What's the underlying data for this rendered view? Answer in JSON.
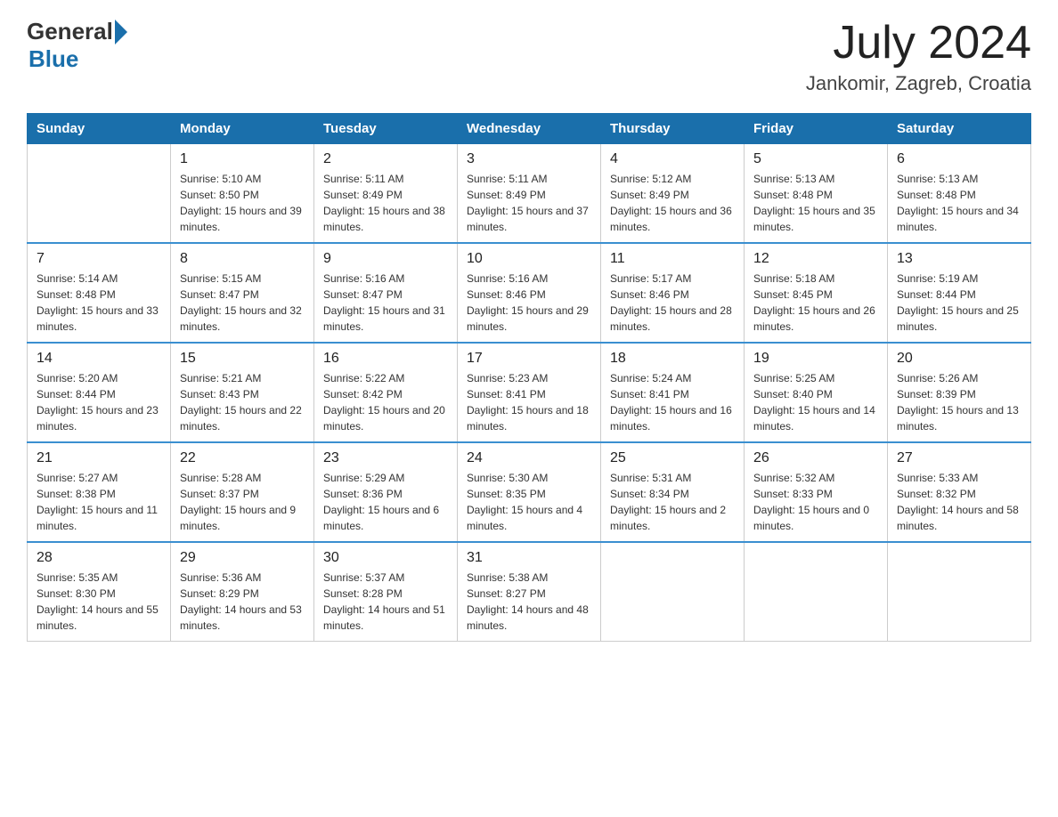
{
  "logo": {
    "general": "General",
    "blue": "Blue"
  },
  "title": {
    "month_year": "July 2024",
    "location": "Jankomir, Zagreb, Croatia"
  },
  "headers": [
    "Sunday",
    "Monday",
    "Tuesday",
    "Wednesday",
    "Thursday",
    "Friday",
    "Saturday"
  ],
  "weeks": [
    [
      {
        "day": "",
        "sunrise": "",
        "sunset": "",
        "daylight": ""
      },
      {
        "day": "1",
        "sunrise": "Sunrise: 5:10 AM",
        "sunset": "Sunset: 8:50 PM",
        "daylight": "Daylight: 15 hours and 39 minutes."
      },
      {
        "day": "2",
        "sunrise": "Sunrise: 5:11 AM",
        "sunset": "Sunset: 8:49 PM",
        "daylight": "Daylight: 15 hours and 38 minutes."
      },
      {
        "day": "3",
        "sunrise": "Sunrise: 5:11 AM",
        "sunset": "Sunset: 8:49 PM",
        "daylight": "Daylight: 15 hours and 37 minutes."
      },
      {
        "day": "4",
        "sunrise": "Sunrise: 5:12 AM",
        "sunset": "Sunset: 8:49 PM",
        "daylight": "Daylight: 15 hours and 36 minutes."
      },
      {
        "day": "5",
        "sunrise": "Sunrise: 5:13 AM",
        "sunset": "Sunset: 8:48 PM",
        "daylight": "Daylight: 15 hours and 35 minutes."
      },
      {
        "day": "6",
        "sunrise": "Sunrise: 5:13 AM",
        "sunset": "Sunset: 8:48 PM",
        "daylight": "Daylight: 15 hours and 34 minutes."
      }
    ],
    [
      {
        "day": "7",
        "sunrise": "Sunrise: 5:14 AM",
        "sunset": "Sunset: 8:48 PM",
        "daylight": "Daylight: 15 hours and 33 minutes."
      },
      {
        "day": "8",
        "sunrise": "Sunrise: 5:15 AM",
        "sunset": "Sunset: 8:47 PM",
        "daylight": "Daylight: 15 hours and 32 minutes."
      },
      {
        "day": "9",
        "sunrise": "Sunrise: 5:16 AM",
        "sunset": "Sunset: 8:47 PM",
        "daylight": "Daylight: 15 hours and 31 minutes."
      },
      {
        "day": "10",
        "sunrise": "Sunrise: 5:16 AM",
        "sunset": "Sunset: 8:46 PM",
        "daylight": "Daylight: 15 hours and 29 minutes."
      },
      {
        "day": "11",
        "sunrise": "Sunrise: 5:17 AM",
        "sunset": "Sunset: 8:46 PM",
        "daylight": "Daylight: 15 hours and 28 minutes."
      },
      {
        "day": "12",
        "sunrise": "Sunrise: 5:18 AM",
        "sunset": "Sunset: 8:45 PM",
        "daylight": "Daylight: 15 hours and 26 minutes."
      },
      {
        "day": "13",
        "sunrise": "Sunrise: 5:19 AM",
        "sunset": "Sunset: 8:44 PM",
        "daylight": "Daylight: 15 hours and 25 minutes."
      }
    ],
    [
      {
        "day": "14",
        "sunrise": "Sunrise: 5:20 AM",
        "sunset": "Sunset: 8:44 PM",
        "daylight": "Daylight: 15 hours and 23 minutes."
      },
      {
        "day": "15",
        "sunrise": "Sunrise: 5:21 AM",
        "sunset": "Sunset: 8:43 PM",
        "daylight": "Daylight: 15 hours and 22 minutes."
      },
      {
        "day": "16",
        "sunrise": "Sunrise: 5:22 AM",
        "sunset": "Sunset: 8:42 PM",
        "daylight": "Daylight: 15 hours and 20 minutes."
      },
      {
        "day": "17",
        "sunrise": "Sunrise: 5:23 AM",
        "sunset": "Sunset: 8:41 PM",
        "daylight": "Daylight: 15 hours and 18 minutes."
      },
      {
        "day": "18",
        "sunrise": "Sunrise: 5:24 AM",
        "sunset": "Sunset: 8:41 PM",
        "daylight": "Daylight: 15 hours and 16 minutes."
      },
      {
        "day": "19",
        "sunrise": "Sunrise: 5:25 AM",
        "sunset": "Sunset: 8:40 PM",
        "daylight": "Daylight: 15 hours and 14 minutes."
      },
      {
        "day": "20",
        "sunrise": "Sunrise: 5:26 AM",
        "sunset": "Sunset: 8:39 PM",
        "daylight": "Daylight: 15 hours and 13 minutes."
      }
    ],
    [
      {
        "day": "21",
        "sunrise": "Sunrise: 5:27 AM",
        "sunset": "Sunset: 8:38 PM",
        "daylight": "Daylight: 15 hours and 11 minutes."
      },
      {
        "day": "22",
        "sunrise": "Sunrise: 5:28 AM",
        "sunset": "Sunset: 8:37 PM",
        "daylight": "Daylight: 15 hours and 9 minutes."
      },
      {
        "day": "23",
        "sunrise": "Sunrise: 5:29 AM",
        "sunset": "Sunset: 8:36 PM",
        "daylight": "Daylight: 15 hours and 6 minutes."
      },
      {
        "day": "24",
        "sunrise": "Sunrise: 5:30 AM",
        "sunset": "Sunset: 8:35 PM",
        "daylight": "Daylight: 15 hours and 4 minutes."
      },
      {
        "day": "25",
        "sunrise": "Sunrise: 5:31 AM",
        "sunset": "Sunset: 8:34 PM",
        "daylight": "Daylight: 15 hours and 2 minutes."
      },
      {
        "day": "26",
        "sunrise": "Sunrise: 5:32 AM",
        "sunset": "Sunset: 8:33 PM",
        "daylight": "Daylight: 15 hours and 0 minutes."
      },
      {
        "day": "27",
        "sunrise": "Sunrise: 5:33 AM",
        "sunset": "Sunset: 8:32 PM",
        "daylight": "Daylight: 14 hours and 58 minutes."
      }
    ],
    [
      {
        "day": "28",
        "sunrise": "Sunrise: 5:35 AM",
        "sunset": "Sunset: 8:30 PM",
        "daylight": "Daylight: 14 hours and 55 minutes."
      },
      {
        "day": "29",
        "sunrise": "Sunrise: 5:36 AM",
        "sunset": "Sunset: 8:29 PM",
        "daylight": "Daylight: 14 hours and 53 minutes."
      },
      {
        "day": "30",
        "sunrise": "Sunrise: 5:37 AM",
        "sunset": "Sunset: 8:28 PM",
        "daylight": "Daylight: 14 hours and 51 minutes."
      },
      {
        "day": "31",
        "sunrise": "Sunrise: 5:38 AM",
        "sunset": "Sunset: 8:27 PM",
        "daylight": "Daylight: 14 hours and 48 minutes."
      },
      {
        "day": "",
        "sunrise": "",
        "sunset": "",
        "daylight": ""
      },
      {
        "day": "",
        "sunrise": "",
        "sunset": "",
        "daylight": ""
      },
      {
        "day": "",
        "sunrise": "",
        "sunset": "",
        "daylight": ""
      }
    ]
  ]
}
